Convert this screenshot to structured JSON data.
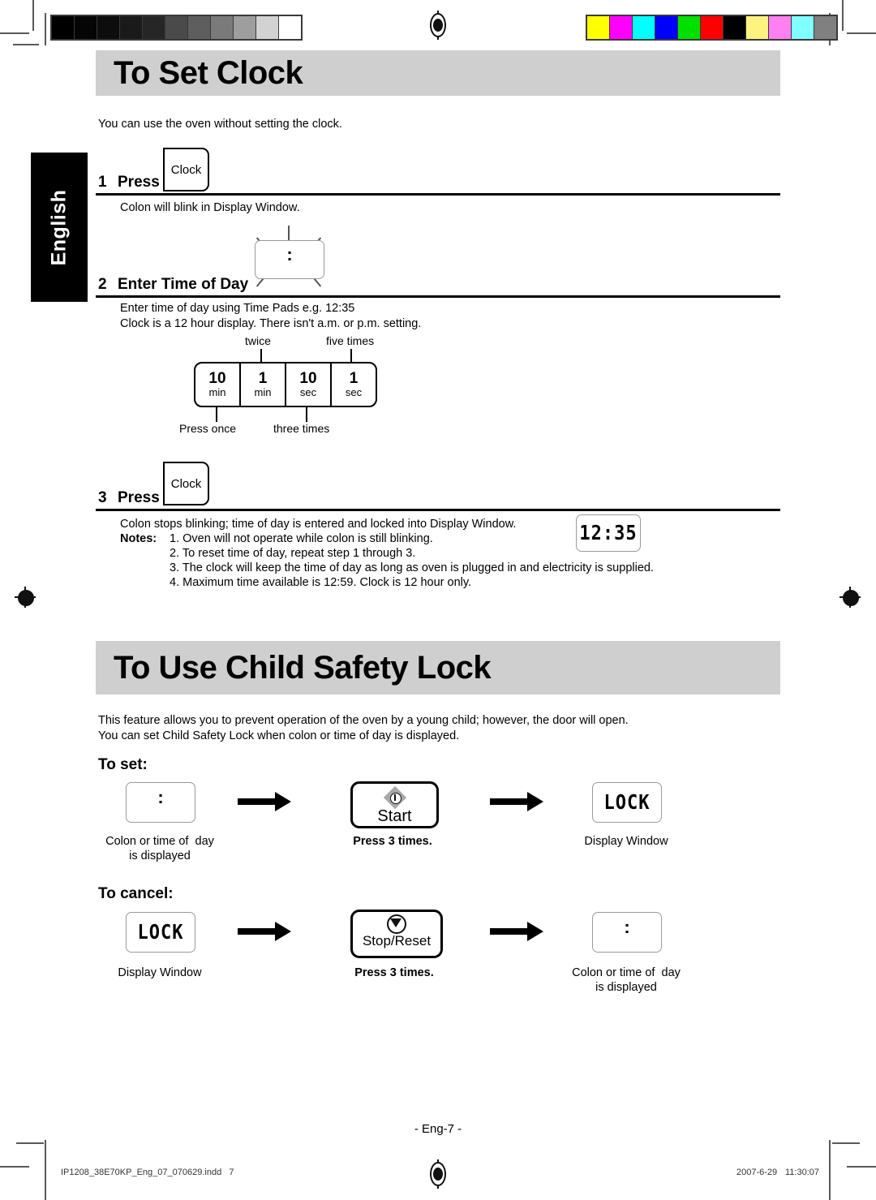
{
  "document": {
    "language_tab": "English",
    "page_number": "- Eng-7 -",
    "footer_file": "IP1208_38E70KP_Eng_07_070629.indd   7",
    "footer_date": "2007-6-29",
    "footer_time": "11:30:07"
  },
  "colors": {
    "banner_gray": "#cfcfcf",
    "tab_black": "#000000",
    "rule_black": "#000000",
    "display_border": "#9a9a9a",
    "start_icon_gray": "#a8a8a8"
  },
  "calibration": {
    "grayscale_swatches": [
      "#000000",
      "#050505",
      "#0d0d0d",
      "#1a1a1a",
      "#262626",
      "#4a4a4a",
      "#5e5e5e",
      "#7a7a7a",
      "#9e9e9e",
      "#d2d2d2",
      "#ffffff"
    ],
    "color_swatches": [
      "#ffff00",
      "#ff00ff",
      "#00ffff",
      "#0000ff",
      "#00e000",
      "#ff0000",
      "#000000",
      "#fff380",
      "#ff80f0",
      "#80ffff",
      "#808080"
    ]
  },
  "section1": {
    "title": "To Set Clock",
    "intro": "You can use the oven without setting the clock.",
    "steps": [
      {
        "num": "1",
        "label": "Press",
        "pad": "Clock",
        "body": "Colon will blink in Display Window."
      },
      {
        "num": "2",
        "label": "Enter Time of Day",
        "body_line1": "Enter time of day using Time Pads e.g. 12:35",
        "body_line2": "Clock is a 12 hour display. There isn't a.m. or p.m. setting."
      },
      {
        "num": "3",
        "label": "Press",
        "pad": "Clock",
        "body": "Colon stops blinking; time of day is entered and locked into Display Window."
      }
    ],
    "time_pads": {
      "cells": [
        {
          "value": "10",
          "unit": "min"
        },
        {
          "value": "1",
          "unit": "min"
        },
        {
          "value": "10",
          "unit": "sec"
        },
        {
          "value": "1",
          "unit": "sec"
        }
      ],
      "callout_above_2": "twice",
      "callout_above_4": "five times",
      "callout_below_1": "Press once",
      "callout_below_3": "three times"
    },
    "notes_label": "Notes:",
    "notes": [
      "1. Oven will not operate while colon is still blinking.",
      "2. To reset time of day, repeat step 1 through 3.",
      "3. The clock will keep the time of day as long as oven is plugged in and electricity is supplied.",
      "4. Maximum time available is 12:59. Clock is 12 hour only."
    ],
    "display_time": "12:35",
    "blink_display": ":"
  },
  "section2": {
    "title": "To Use Child Safety Lock",
    "intro_line1": "This feature allows you to prevent operation of the oven by a young child; however, the door will open.",
    "intro_line2": "You can set Child Safety Lock when colon or time of day is displayed.",
    "to_set": {
      "heading": "To set:",
      "step1_display": ":",
      "step1_caption_line1": "Colon or time of  day",
      "step1_caption_line2": "is displayed",
      "button_label": "Start",
      "button_caption": "Press 3 times.",
      "result_display": "LOCK",
      "result_caption": "Display Window"
    },
    "to_cancel": {
      "heading": "To cancel:",
      "step1_display": "LOCK",
      "step1_caption": "Display Window",
      "button_label": "Stop/Reset",
      "button_caption": "Press 3 times.",
      "result_display": ":",
      "result_caption_line1": "Colon or time of  day",
      "result_caption_line2": "is displayed"
    }
  }
}
